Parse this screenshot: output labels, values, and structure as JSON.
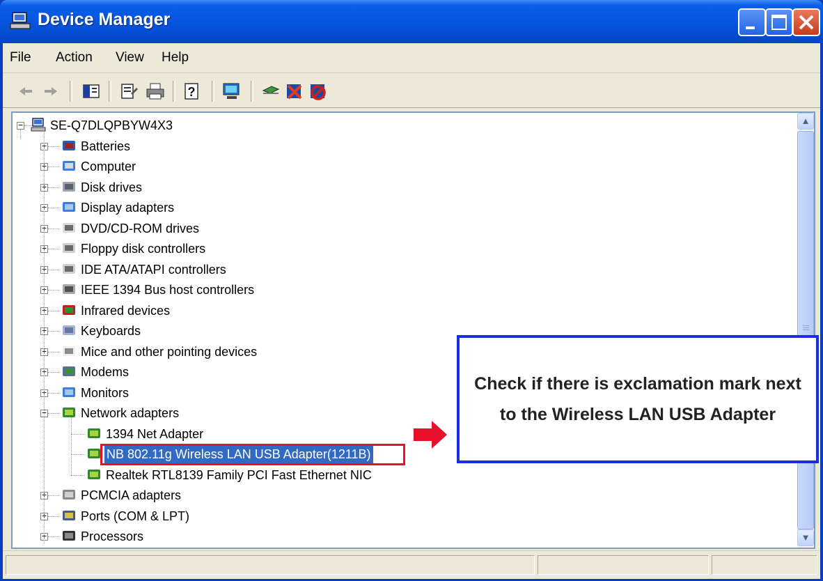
{
  "window": {
    "title": "Device Manager"
  },
  "menu": [
    "File",
    "Action",
    "View",
    "Help"
  ],
  "tree": {
    "root": "SE-Q7DLQPBYW4X3",
    "categories": [
      {
        "label": "Batteries",
        "icon": "battery-icon",
        "expanded": false
      },
      {
        "label": "Computer",
        "icon": "computer-icon",
        "expanded": false
      },
      {
        "label": "Disk drives",
        "icon": "disk-drive-icon",
        "expanded": false
      },
      {
        "label": "Display adapters",
        "icon": "display-adapter-icon",
        "expanded": false
      },
      {
        "label": "DVD/CD-ROM drives",
        "icon": "dvd-drive-icon",
        "expanded": false
      },
      {
        "label": "Floppy disk controllers",
        "icon": "floppy-controller-icon",
        "expanded": false
      },
      {
        "label": "IDE ATA/ATAPI controllers",
        "icon": "ide-controller-icon",
        "expanded": false
      },
      {
        "label": "IEEE 1394 Bus host controllers",
        "icon": "ieee1394-icon",
        "expanded": false
      },
      {
        "label": "Infrared devices",
        "icon": "infrared-icon",
        "expanded": false
      },
      {
        "label": "Keyboards",
        "icon": "keyboard-icon",
        "expanded": false
      },
      {
        "label": "Mice and other pointing devices",
        "icon": "mouse-icon",
        "expanded": false
      },
      {
        "label": "Modems",
        "icon": "modem-icon",
        "expanded": false
      },
      {
        "label": "Monitors",
        "icon": "monitor-icon",
        "expanded": false
      },
      {
        "label": "Network adapters",
        "icon": "network-adapter-icon",
        "expanded": true
      },
      {
        "label": "PCMCIA adapters",
        "icon": "pcmcia-icon",
        "expanded": false
      },
      {
        "label": "Ports (COM & LPT)",
        "icon": "port-icon",
        "expanded": false
      },
      {
        "label": "Processors",
        "icon": "processor-icon",
        "expanded": false
      }
    ],
    "network_children": [
      "1394 Net Adapter",
      "NB 802.11g Wireless LAN USB Adapter(1211B)",
      "Realtek RTL8139 Family PCI Fast Ethernet NIC"
    ],
    "selected": "NB 802.11g Wireless LAN USB Adapter(1211B)"
  },
  "callout": {
    "text": "Check if there is exclamation mark next to the Wireless LAN USB Adapter"
  },
  "colors": {
    "title_blue": "#0553db",
    "selection": "#316ac5",
    "highlight_red": "#e8102a",
    "callout_border": "#1a2fe0"
  }
}
